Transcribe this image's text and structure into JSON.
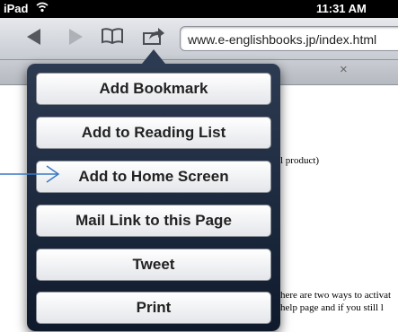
{
  "status_bar": {
    "carrier": "iPad",
    "time": "11:31 AM"
  },
  "toolbar": {
    "url": "www.e-englishbooks.jp/index.html",
    "icons": [
      "back-icon",
      "forward-icon",
      "bookmarks-icon",
      "share-icon"
    ]
  },
  "tab_bar": {
    "close_label": "×"
  },
  "page": {
    "fragment_1": "l product)",
    "fragment_2": "here are two ways to activat",
    "fragment_3": "help page and if you still l"
  },
  "share_menu": {
    "items": [
      "Add Bookmark",
      "Add to Reading List",
      "Add to Home Screen",
      "Mail Link to this Page",
      "Tweet",
      "Print"
    ]
  },
  "colors": {
    "popover": "#1c2a40",
    "annotation_arrow": "#3a79c4"
  }
}
